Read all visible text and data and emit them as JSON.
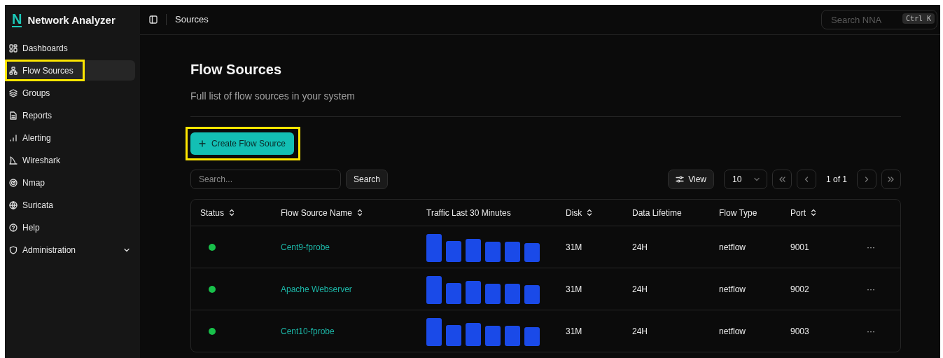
{
  "app": {
    "logo_letter": "N",
    "name": "Network Analyzer"
  },
  "sidebar": {
    "items": [
      {
        "label": "Dashboards",
        "kind": "grid",
        "selected": false,
        "highlighted": false
      },
      {
        "label": "Flow Sources",
        "kind": "network",
        "selected": true,
        "highlighted": true
      },
      {
        "label": "Groups",
        "kind": "layers",
        "selected": false,
        "highlighted": false
      },
      {
        "label": "Reports",
        "kind": "file",
        "selected": false,
        "highlighted": false
      },
      {
        "label": "Alerting",
        "kind": "chart",
        "selected": false,
        "highlighted": false
      },
      {
        "label": "Wireshark",
        "kind": "fin",
        "selected": false,
        "highlighted": false
      },
      {
        "label": "Nmap",
        "kind": "radar",
        "selected": false,
        "highlighted": false
      },
      {
        "label": "Suricata",
        "kind": "globe",
        "selected": false,
        "highlighted": false
      },
      {
        "label": "Help",
        "kind": "help",
        "selected": false,
        "highlighted": false
      },
      {
        "label": "Administration",
        "kind": "shield",
        "selected": false,
        "highlighted": false,
        "expandable": true
      }
    ]
  },
  "header": {
    "breadcrumb": "Sources",
    "search": {
      "placeholder": "Search NNA",
      "shortcut": "Ctrl K"
    }
  },
  "page": {
    "title": "Flow Sources",
    "subtitle": "Full list of flow sources in your system",
    "create_button": {
      "label": "Create Flow Source",
      "highlighted": true
    },
    "search": {
      "placeholder": "Search...",
      "button": "Search"
    },
    "view_button": "View",
    "page_size": "10",
    "pagination": "1 of 1"
  },
  "table": {
    "columns": [
      {
        "label": "Status",
        "sortable": true
      },
      {
        "label": "Flow Source Name",
        "sortable": true
      },
      {
        "label": "Traffic Last 30 Minutes",
        "sortable": false
      },
      {
        "label": "Disk",
        "sortable": true
      },
      {
        "label": "Data Lifetime",
        "sortable": false
      },
      {
        "label": "Flow Type",
        "sortable": false
      },
      {
        "label": "Port",
        "sortable": true
      }
    ],
    "rows": [
      {
        "color": "#18c04a",
        "name": "Cent9-fprobe",
        "disk": "31M",
        "lifetime": "24H",
        "flow_type": "netflow",
        "port": "9001",
        "actions": "···"
      },
      {
        "color": "#18c04a",
        "name": "Apache Webserver",
        "disk": "31M",
        "lifetime": "24H",
        "flow_type": "netflow",
        "port": "9002",
        "actions": "···"
      },
      {
        "color": "#18c04a",
        "name": "Cent10-fprobe",
        "disk": "31M",
        "lifetime": "24H",
        "flow_type": "netflow",
        "port": "9003",
        "actions": "···"
      }
    ]
  }
}
